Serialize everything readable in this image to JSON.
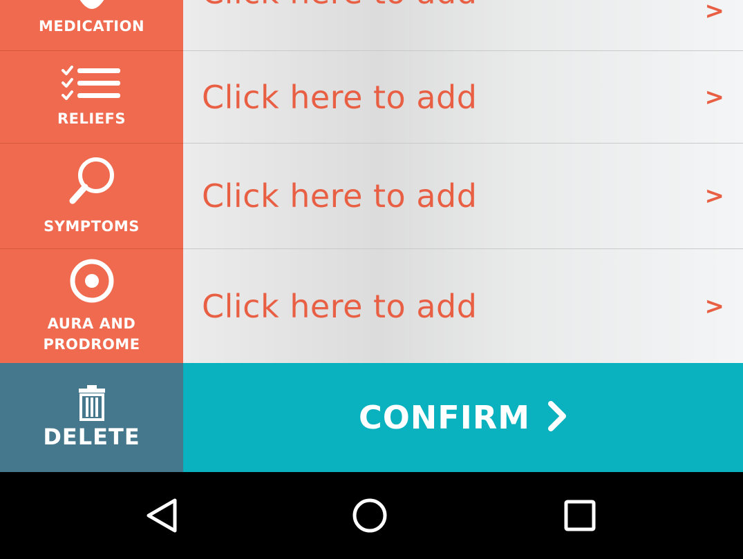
{
  "rows": [
    {
      "label": "MEDICATION",
      "placeholder": "Click here to add",
      "chevron": ">"
    },
    {
      "label": "RELIEFS",
      "placeholder": "Click here to add",
      "chevron": ">"
    },
    {
      "label": "SYMPTOMS",
      "placeholder": "Click here to add",
      "chevron": ">"
    },
    {
      "label_line1": "AURA AND",
      "label_line2": "PRODROME",
      "placeholder": "Click here to add",
      "chevron": ">"
    }
  ],
  "actions": {
    "delete_label": "DELETE",
    "confirm_label": "CONFIRM"
  },
  "icons": {
    "medication": "pill-icon",
    "reliefs": "checklist-icon",
    "symptoms": "magnifier-icon",
    "aura": "target-icon",
    "delete": "trash-icon",
    "confirm": "chevron-right-icon"
  },
  "colors": {
    "category_bg": "#ef6a4e",
    "accent_text": "#e85f44",
    "delete_bg": "#45788c",
    "confirm_bg": "#0ab1be",
    "nav_bg": "#000000"
  }
}
